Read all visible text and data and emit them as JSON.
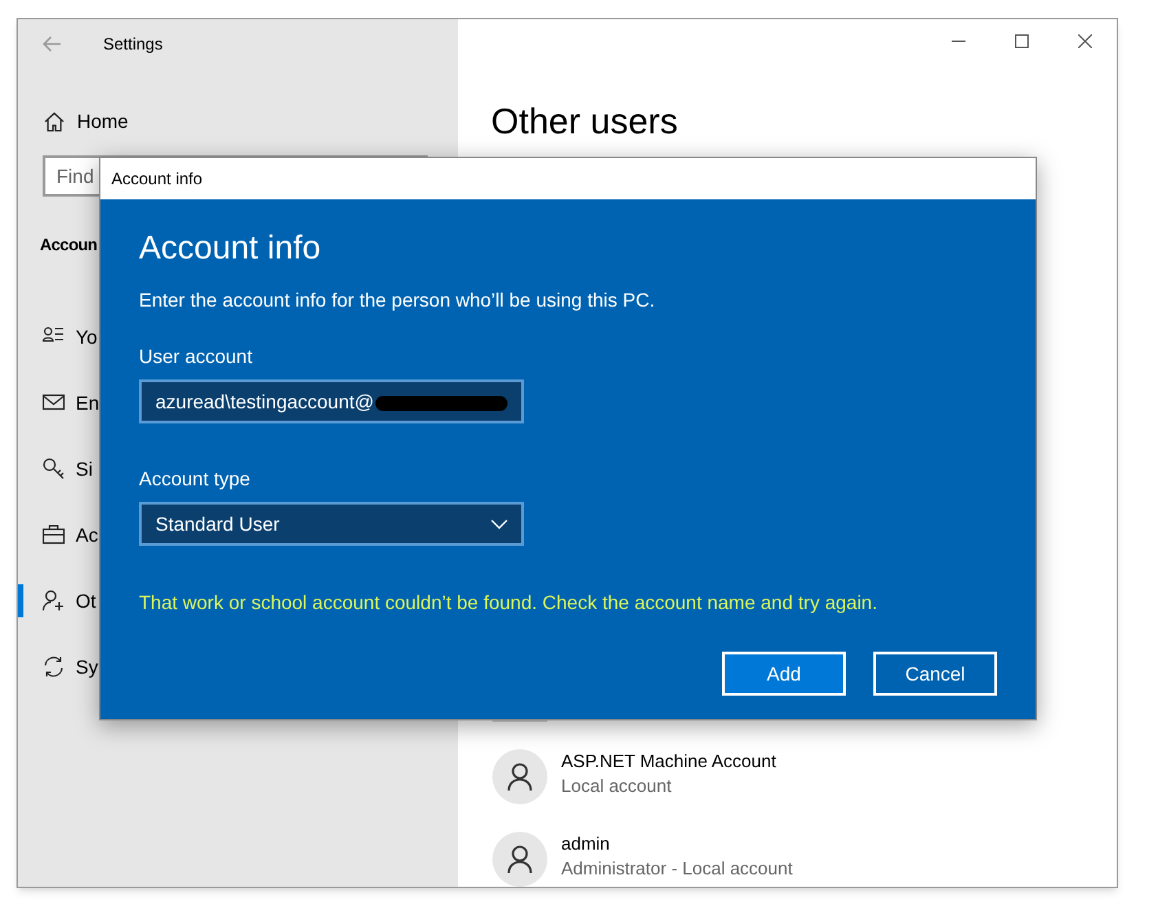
{
  "settings_window": {
    "title": "Settings"
  },
  "sidebar": {
    "home": "Home",
    "search": {
      "placeholder": "Find"
    },
    "section": "Accoun",
    "items": [
      {
        "label": "Yo",
        "kind": "person-list",
        "selected": false
      },
      {
        "label": "En",
        "kind": "mail",
        "selected": false
      },
      {
        "label": "Si",
        "kind": "key",
        "selected": false
      },
      {
        "label": "Ac",
        "kind": "briefcase",
        "selected": false
      },
      {
        "label": "Ot",
        "kind": "person-add",
        "selected": true
      },
      {
        "label": "Sy",
        "kind": "sync",
        "selected": false
      }
    ]
  },
  "page": {
    "heading": "Other users",
    "users": [
      {
        "name": "ASP.NET Machine Account",
        "detail": "Local account"
      },
      {
        "name": "admin",
        "detail": "Administrator - Local account"
      }
    ]
  },
  "dialog": {
    "title": "Account info",
    "heading": "Account info",
    "instruction": "Enter the account info for the person who’ll be using this PC.",
    "user_account": {
      "label": "User account",
      "value": "azuread\\testingaccount@",
      "redacted": true
    },
    "account_type": {
      "label": "Account type",
      "value": "Standard User"
    },
    "error": "That work or school account couldn’t be found. Check the account name and try again.",
    "buttons": [
      {
        "label": "Add",
        "kind": "primary"
      },
      {
        "label": "Cancel",
        "kind": "secondary"
      }
    ]
  }
}
